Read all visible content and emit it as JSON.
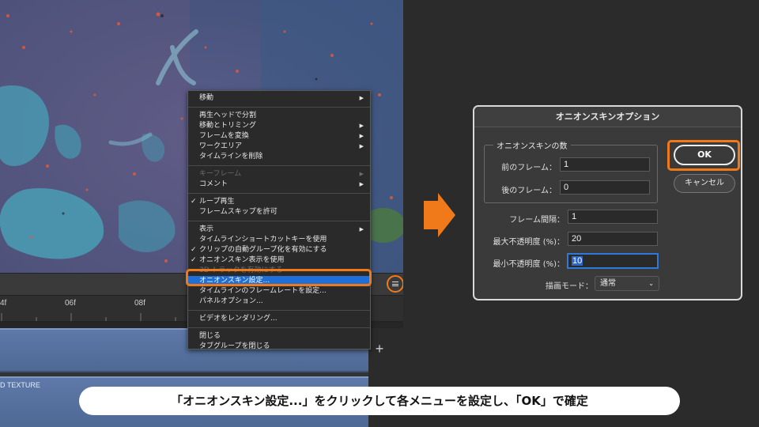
{
  "timeline": {
    "ruler_labels": [
      "4f",
      "06f",
      "08f"
    ],
    "track_label": "D TEXTURE",
    "plus": "+"
  },
  "menu": {
    "groups": [
      [
        {
          "label": "移動",
          "submenu": true
        }
      ],
      [
        {
          "label": "再生ヘッドで分割"
        },
        {
          "label": "移動とトリミング",
          "submenu": true
        },
        {
          "label": "フレームを変換",
          "submenu": true
        },
        {
          "label": "ワークエリア",
          "submenu": true
        },
        {
          "label": "タイムラインを削除"
        }
      ],
      [
        {
          "label": "キーフレーム",
          "submenu": true,
          "disabled": true
        },
        {
          "label": "コメント",
          "submenu": true
        }
      ],
      [
        {
          "label": "ループ再生",
          "checked": true
        },
        {
          "label": "フレームスキップを許可"
        }
      ],
      [
        {
          "label": "表示",
          "submenu": true
        },
        {
          "label": "タイムラインショートカットキーを使用"
        },
        {
          "label": "クリップの自動グループ化を有効にする",
          "checked": true
        },
        {
          "label": "オニオンスキン表示を使用",
          "checked": true
        },
        {
          "label": "3D トラックを有効にする",
          "disabled": true
        },
        {
          "label": "オニオンスキン設定...",
          "highlighted": true
        },
        {
          "label": "タイムラインのフレームレートを設定..."
        },
        {
          "label": "パネルオプション..."
        }
      ],
      [
        {
          "label": "ビデオをレンダリング..."
        }
      ],
      [
        {
          "label": "閉じる"
        },
        {
          "label": "タブグループを閉じる"
        }
      ]
    ],
    "check_glyph": "✓",
    "arrow_glyph": "▶"
  },
  "dialog": {
    "title": "オニオンスキンオプション",
    "group_title": "オニオンスキンの数",
    "prev_frames_label": "前のフレーム：",
    "prev_frames_value": "1",
    "next_frames_label": "後のフレーム：",
    "next_frames_value": "0",
    "frame_spacing_label": "フレーム間隔：",
    "frame_spacing_value": "1",
    "max_opacity_label": "最大不透明度 (%)：",
    "max_opacity_value": "20",
    "min_opacity_label": "最小不透明度 (%)：",
    "min_opacity_value": "10",
    "blend_mode_label": "描画モード：",
    "blend_mode_value": "通常",
    "ok_label": "OK",
    "cancel_label": "キャンセル"
  },
  "caption": "「オニオンスキン設定...」をクリックして各メニューを設定し、「OK」で確定",
  "colors": {
    "highlight_orange": "#f07a1a",
    "menu_selection_blue": "#1f6fd6",
    "track_blue": "#5e79a8"
  }
}
